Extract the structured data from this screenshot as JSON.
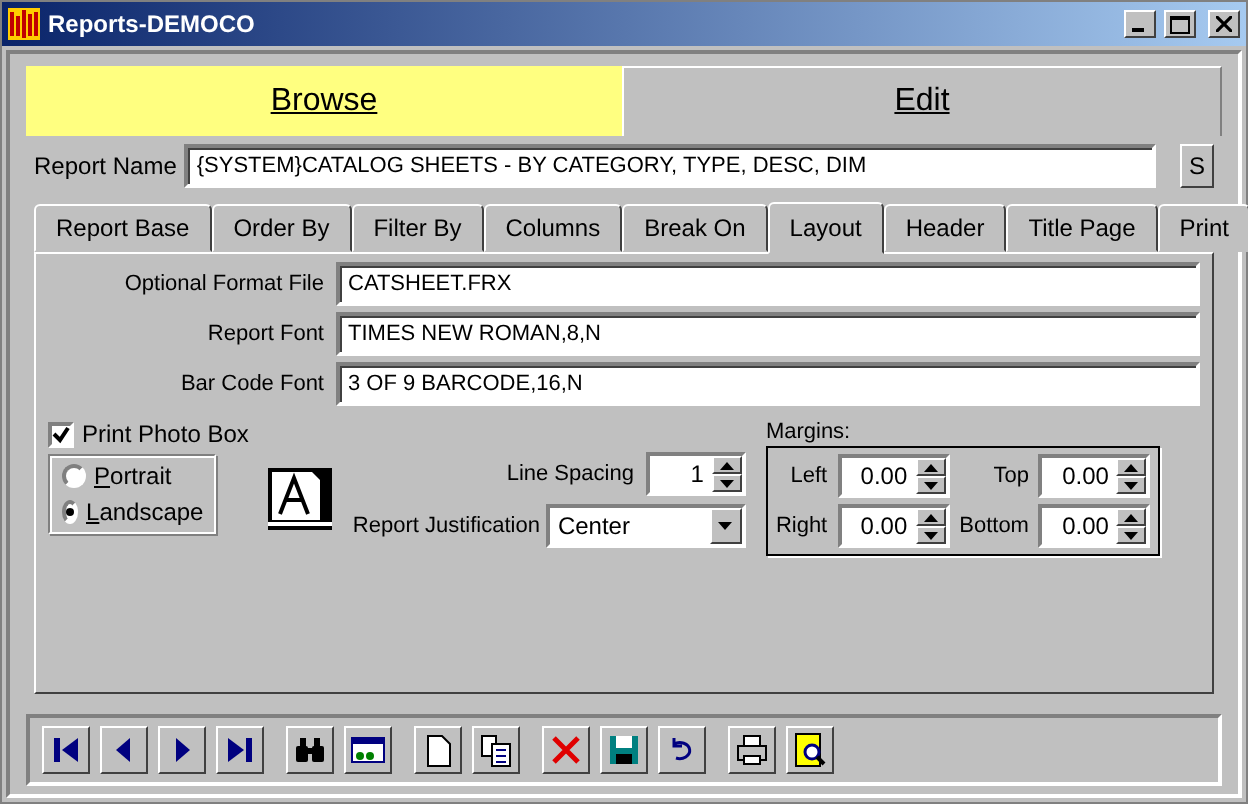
{
  "window": {
    "title": "Reports-DEMOCO"
  },
  "modes": [
    {
      "label": "Browse",
      "selected": false
    },
    {
      "label": "Edit",
      "selected": true
    }
  ],
  "report_name": {
    "label": "Report Name",
    "value": "{SYSTEM}CATALOG SHEETS - BY CATEGORY, TYPE, DESC, DIM",
    "button": "S"
  },
  "tabs": [
    {
      "label": "Report Base",
      "selected": false
    },
    {
      "label": "Order By",
      "selected": false
    },
    {
      "label": "Filter By",
      "selected": false
    },
    {
      "label": "Columns",
      "selected": false
    },
    {
      "label": "Break On",
      "selected": false
    },
    {
      "label": "Layout",
      "selected": true
    },
    {
      "label": "Header",
      "selected": false
    },
    {
      "label": "Title Page",
      "selected": false
    },
    {
      "label": "Print",
      "selected": false
    }
  ],
  "fields": [
    {
      "label": "Optional Format File",
      "value": "CATSHEET.FRX"
    },
    {
      "label": "Report Font",
      "value": "TIMES NEW ROMAN,8,N"
    },
    {
      "label": "Bar Code Font",
      "value": "3 OF 9 BARCODE,16,N"
    }
  ],
  "print_photo_box": {
    "label": "Print Photo Box",
    "checked": true
  },
  "orientation": [
    {
      "label": "Portrait",
      "selected": false
    },
    {
      "label": "Landscape",
      "selected": true
    }
  ],
  "line_spacing": {
    "label": "Line Spacing",
    "value": "1"
  },
  "justification": {
    "label": "Report Justification",
    "value": "Center"
  },
  "margins": {
    "title": "Margins:",
    "items": [
      {
        "label": "Left",
        "value": "0.00"
      },
      {
        "label": "Top",
        "value": "0.00"
      },
      {
        "label": "Right",
        "value": "0.00"
      },
      {
        "label": "Bottom",
        "value": "0.00"
      }
    ]
  },
  "toolbar": [
    {
      "kind": "first"
    },
    {
      "kind": "prev"
    },
    {
      "kind": "next"
    },
    {
      "kind": "last"
    },
    {
      "kind": "find"
    },
    {
      "kind": "form"
    },
    {
      "kind": "new"
    },
    {
      "kind": "copy"
    },
    {
      "kind": "delete"
    },
    {
      "kind": "save"
    },
    {
      "kind": "undo"
    },
    {
      "kind": "print"
    },
    {
      "kind": "preview"
    }
  ]
}
